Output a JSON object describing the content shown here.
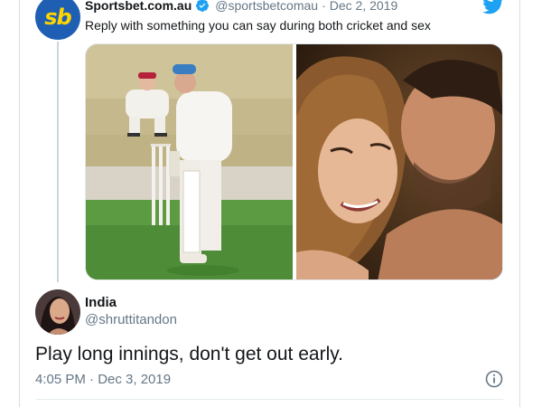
{
  "parent_tweet": {
    "avatar_text": "sb",
    "name": "Sportsbet.com.au",
    "handle": "@sportsbetcomau",
    "separator": "·",
    "date": "Dec 2, 2019",
    "text": "Reply with something you can say during both cricket and sex",
    "verified_icon": "verified-badge-icon",
    "platform_icon": "twitter-bird-icon"
  },
  "media": {
    "left_image": "cricket-wicketkeeper-and-batsman",
    "right_image": "couple-embracing"
  },
  "reply_tweet": {
    "name": "India",
    "handle": "@shruttitandon",
    "text": "Play long innings, don't get out early.",
    "time": "4:05 PM · Dec 3, 2019",
    "info_icon": "info-icon"
  },
  "colors": {
    "brand_blue": "#1da1f2",
    "sportsbet_blue": "#1f5fb3",
    "sportsbet_yellow": "#ffd500",
    "secondary_text": "#657786",
    "primary_text": "#14171a"
  }
}
